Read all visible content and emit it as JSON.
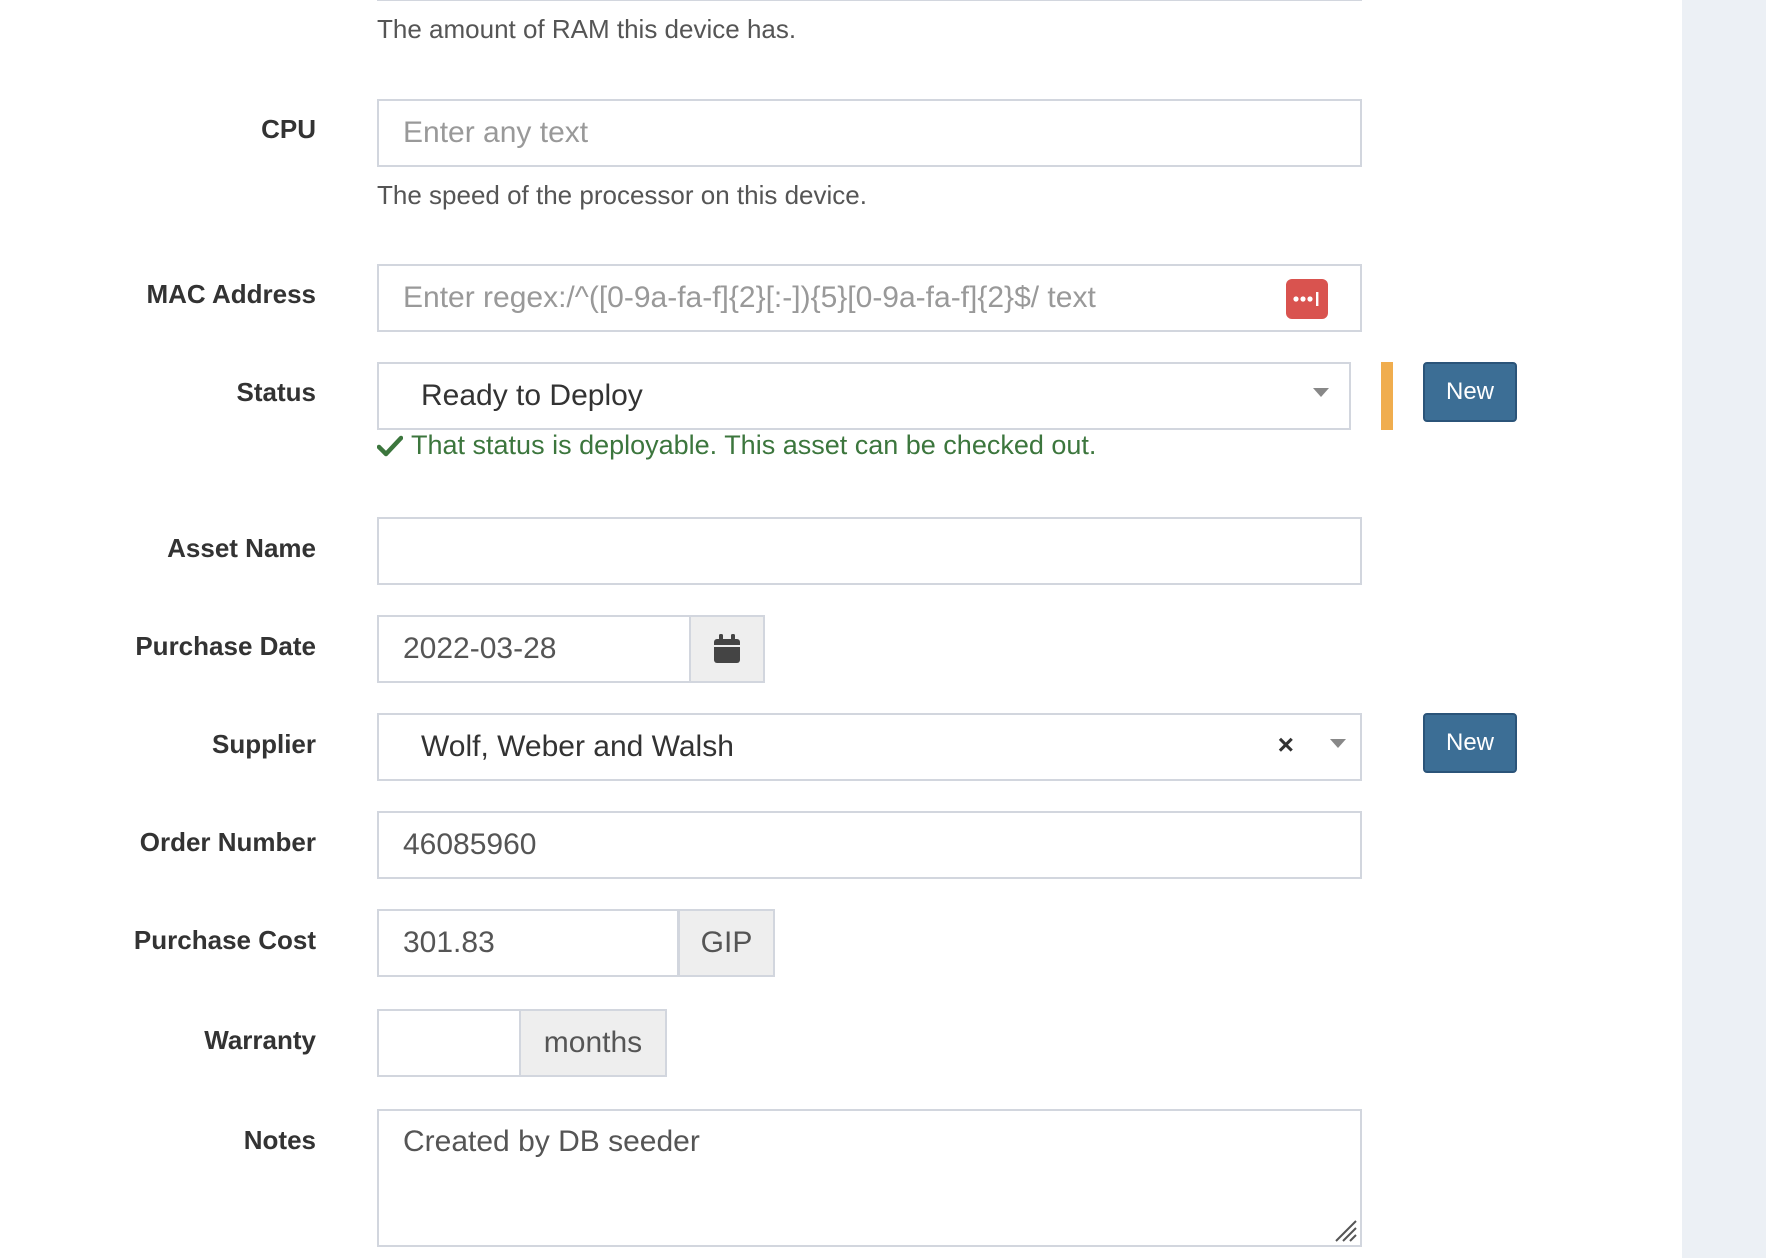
{
  "ram": {
    "help": "The amount of RAM this device has."
  },
  "cpu": {
    "label": "CPU",
    "placeholder": "Enter any text",
    "help": "The speed of the processor on this device."
  },
  "mac": {
    "label": "MAC Address",
    "placeholder": "Enter regex:/^([0-9a-fa-f]{2}[:-]){5}[0-9a-fa-f]{2}$/ text",
    "icon": "password-manager-icon"
  },
  "status": {
    "label": "Status",
    "selected": "Ready to Deploy",
    "message": "That status is deployable. This asset can be checked out.",
    "new_label": "New",
    "indicator_color": "#f0ad4e"
  },
  "asset_name": {
    "label": "Asset Name",
    "value": ""
  },
  "purchase_date": {
    "label": "Purchase Date",
    "value": "2022-03-28",
    "icon": "calendar-icon"
  },
  "supplier": {
    "label": "Supplier",
    "selected": "Wolf, Weber and Walsh",
    "clear": "×",
    "new_label": "New"
  },
  "order_number": {
    "label": "Order Number",
    "value": "46085960"
  },
  "purchase_cost": {
    "label": "Purchase Cost",
    "value": "301.83",
    "currency": "GIP"
  },
  "warranty": {
    "label": "Warranty",
    "value": "",
    "unit": "months"
  },
  "notes": {
    "label": "Notes",
    "value": "Created by DB seeder"
  },
  "colors": {
    "accent_button": "#3c6e95",
    "success_text": "#3c763d",
    "mac_icon": "#d9534f",
    "gutter": "#ecf0f5"
  }
}
